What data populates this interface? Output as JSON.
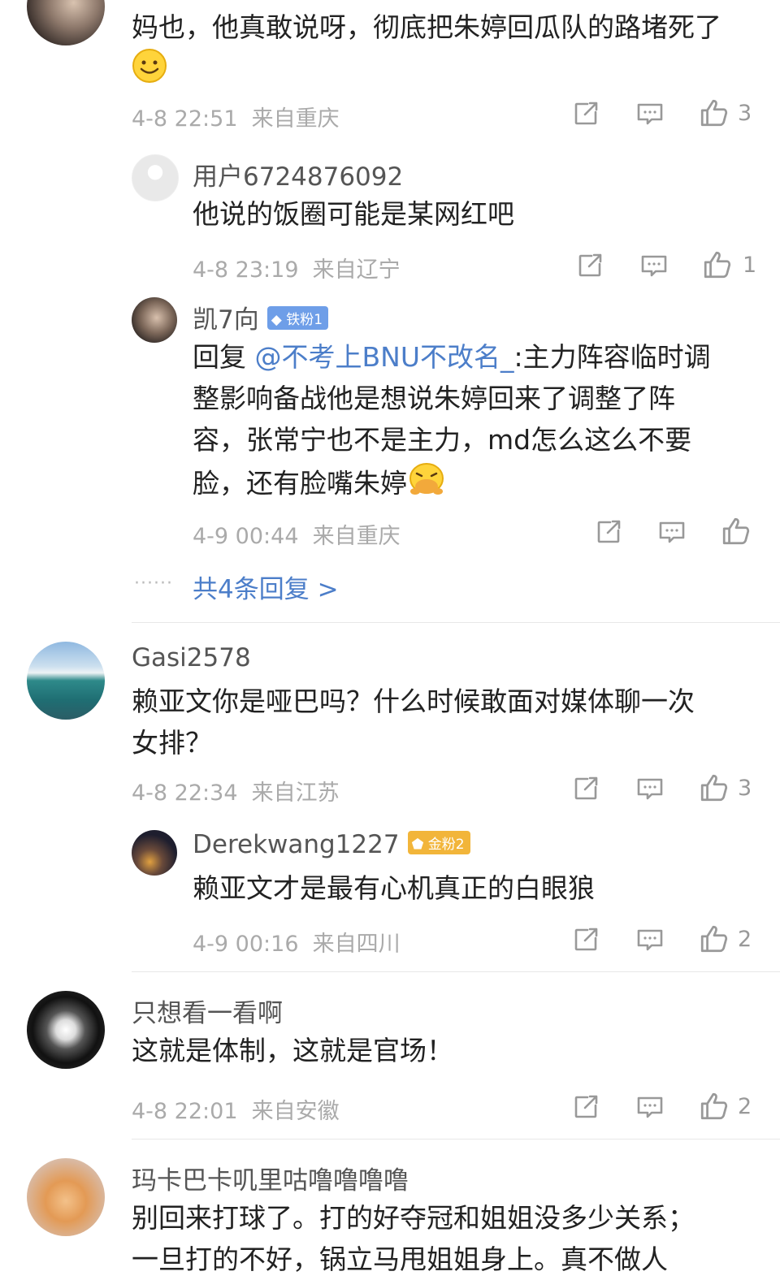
{
  "comments": [
    {
      "text_part1": "妈也，他真敢说呀，彻底把朱婷回瓜队的路堵死了",
      "emoji": "smile-emoji",
      "time": "4-8 22:51",
      "location": "来自重庆",
      "likes": "3",
      "replies": [
        {
          "user": "用户6724876092",
          "text": "他说的饭圈可能是某网红吧",
          "time": "4-8 23:19",
          "location": "来自辽宁",
          "likes": "1"
        },
        {
          "user": "凯7向",
          "badge": "铁粉1",
          "reply_prefix": "回复",
          "mention": "@不考上BNU不改名_",
          "text_line1_rest": ":主力阵容临时调",
          "text_line2": "整影响备战他是想说朱婷回来了调整了阵",
          "text_line3": "容，张常宁也不是主力，md怎么这么不要",
          "text_line4": "脸，还有脸嘴朱婷",
          "emoji": "vomit-emoji",
          "time": "4-9 00:44",
          "location": "来自重庆",
          "likes": ""
        }
      ],
      "more": {
        "dots": "······",
        "label": "共4条回复 >"
      }
    },
    {
      "user": "Gasi2578",
      "text_line1": "赖亚文你是哑巴吗？什么时候敢面对媒体聊一次",
      "text_line2": "女排？",
      "time": "4-8 22:34",
      "location": "来自江苏",
      "likes": "3",
      "replies": [
        {
          "user": "Derekwang1227",
          "badge": "金粉2",
          "text": "赖亚文才是最有心机真正的白眼狼",
          "time": "4-9 00:16",
          "location": "来自四川",
          "likes": "2"
        }
      ]
    },
    {
      "user": "只想看一看啊",
      "text": "这就是体制，这就是官场！",
      "time": "4-8 22:01",
      "location": "来自安徽",
      "likes": "2"
    },
    {
      "user": "玛卡巴卡叽里咕噜噜噜噜",
      "text_line1": "别回来打球了。打的好夺冠和姐姐没多少关系；",
      "text_line2": "一旦打的不好，锅立马甩姐姐身上。真不做人"
    }
  ],
  "colors": {
    "link": "#4c7ec9",
    "iron_badge": "#6e9ee8",
    "gold_badge": "#f2b53a",
    "meta": "#aaaaaa"
  },
  "icons": [
    "share-icon",
    "comment-icon",
    "like-icon"
  ]
}
